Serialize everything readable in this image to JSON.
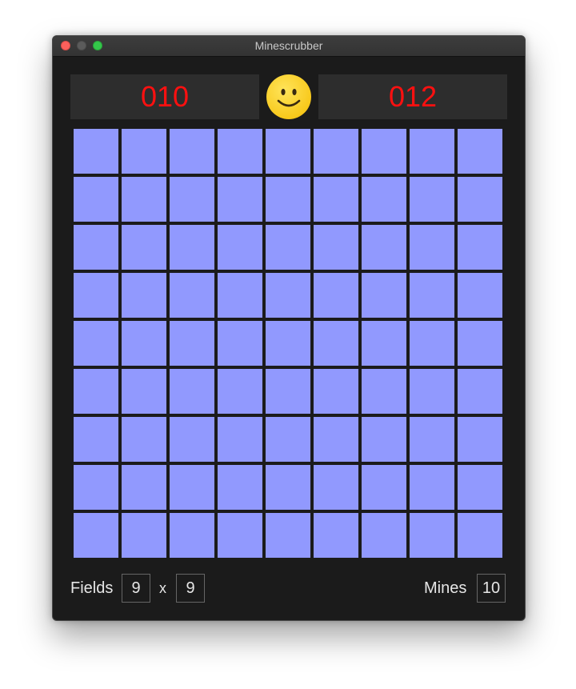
{
  "window": {
    "title": "Minescrubber"
  },
  "header": {
    "left_counter": "010",
    "right_counter": "012",
    "face_icon": "smiley-face-icon",
    "counter_color": "#ff1010"
  },
  "board": {
    "rows": 9,
    "cols": 9,
    "cell_color": "#9199fe",
    "cell_state": "covered"
  },
  "footer": {
    "fields_label": "Fields",
    "width_value": "9",
    "times_label": "x",
    "height_value": "9",
    "mines_label": "Mines",
    "mines_value": "10"
  },
  "colors": {
    "window_bg": "#1b1b1b",
    "counter_bg": "#2d2d2d",
    "smiley": "#f8c91c"
  }
}
